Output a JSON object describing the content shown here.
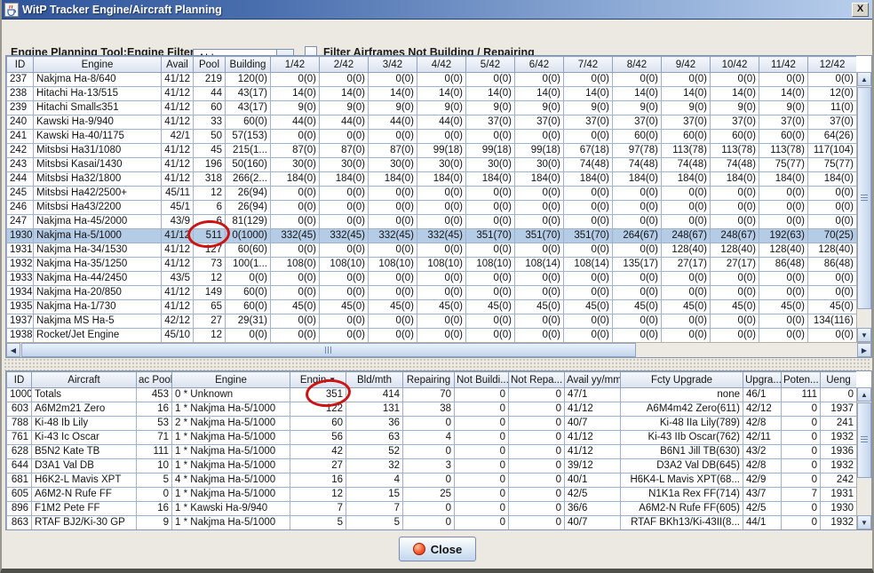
{
  "window": {
    "title": "WitP Tracker Engine/Aircraft Planning",
    "close_glyph": "X"
  },
  "toolbar": {
    "tool_label": "Engine Planning Tool:",
    "filter_label": "Engine Filter:",
    "filter_value": "ALL",
    "checkbox_label": "Filter Airframes Not Building / Repairing",
    "checkbox_checked": false
  },
  "engine_table": {
    "columns": [
      "ID",
      "Engine",
      "Avail",
      "Pool",
      "Building",
      "1/42",
      "2/42",
      "3/42",
      "4/42",
      "5/42",
      "6/42",
      "7/42",
      "8/42",
      "9/42",
      "10/42",
      "11/42",
      "12/42"
    ],
    "selected_row_id": "1930",
    "rows": [
      [
        "237",
        "Nakjma Ha-8/640",
        "41/12",
        "219",
        "120(0)",
        "0(0)",
        "0(0)",
        "0(0)",
        "0(0)",
        "0(0)",
        "0(0)",
        "0(0)",
        "0(0)",
        "0(0)",
        "0(0)",
        "0(0)",
        "0(0)"
      ],
      [
        "238",
        "Hitachi Ha-13/515",
        "41/12",
        "44",
        "43(17)",
        "14(0)",
        "14(0)",
        "14(0)",
        "14(0)",
        "14(0)",
        "14(0)",
        "14(0)",
        "14(0)",
        "14(0)",
        "14(0)",
        "14(0)",
        "12(0)"
      ],
      [
        "239",
        "Hitachi Small≤351",
        "41/12",
        "60",
        "43(17)",
        "9(0)",
        "9(0)",
        "9(0)",
        "9(0)",
        "9(0)",
        "9(0)",
        "9(0)",
        "9(0)",
        "9(0)",
        "9(0)",
        "9(0)",
        "11(0)"
      ],
      [
        "240",
        "Kawski Ha-9/940",
        "41/12",
        "33",
        "60(0)",
        "44(0)",
        "44(0)",
        "44(0)",
        "44(0)",
        "37(0)",
        "37(0)",
        "37(0)",
        "37(0)",
        "37(0)",
        "37(0)",
        "37(0)",
        "37(0)"
      ],
      [
        "241",
        "Kawski Ha-40/1175",
        "42/1",
        "50",
        "57(153)",
        "0(0)",
        "0(0)",
        "0(0)",
        "0(0)",
        "0(0)",
        "0(0)",
        "0(0)",
        "60(0)",
        "60(0)",
        "60(0)",
        "60(0)",
        "64(26)"
      ],
      [
        "242",
        "Mitsbsi Ha31/1080",
        "41/12",
        "45",
        "215(1...",
        "87(0)",
        "87(0)",
        "87(0)",
        "99(18)",
        "99(18)",
        "99(18)",
        "67(18)",
        "97(78)",
        "113(78)",
        "113(78)",
        "113(78)",
        "117(104)"
      ],
      [
        "243",
        "Mitsbsi Kasai/1430",
        "41/12",
        "196",
        "50(160)",
        "30(0)",
        "30(0)",
        "30(0)",
        "30(0)",
        "30(0)",
        "30(0)",
        "74(48)",
        "74(48)",
        "74(48)",
        "74(48)",
        "75(77)",
        "75(77)"
      ],
      [
        "244",
        "Mitsbsi Ha32/1800",
        "41/12",
        "318",
        "266(2...",
        "184(0)",
        "184(0)",
        "184(0)",
        "184(0)",
        "184(0)",
        "184(0)",
        "184(0)",
        "184(0)",
        "184(0)",
        "184(0)",
        "184(0)",
        "184(0)"
      ],
      [
        "245",
        "Mitsbsi Ha42/2500+",
        "45/11",
        "12",
        "26(94)",
        "0(0)",
        "0(0)",
        "0(0)",
        "0(0)",
        "0(0)",
        "0(0)",
        "0(0)",
        "0(0)",
        "0(0)",
        "0(0)",
        "0(0)",
        "0(0)"
      ],
      [
        "246",
        "Mitsbsi Ha43/2200",
        "45/1",
        "6",
        "26(94)",
        "0(0)",
        "0(0)",
        "0(0)",
        "0(0)",
        "0(0)",
        "0(0)",
        "0(0)",
        "0(0)",
        "0(0)",
        "0(0)",
        "0(0)",
        "0(0)"
      ],
      [
        "247",
        "Nakjma Ha-45/2000",
        "43/9",
        "6",
        "81(129)",
        "0(0)",
        "0(0)",
        "0(0)",
        "0(0)",
        "0(0)",
        "0(0)",
        "0(0)",
        "0(0)",
        "0(0)",
        "0(0)",
        "0(0)",
        "0(0)"
      ],
      [
        "1930",
        "Nakjma Ha-5/1000",
        "41/12",
        "511",
        "0(1000)",
        "332(45)",
        "332(45)",
        "332(45)",
        "332(45)",
        "351(70)",
        "351(70)",
        "351(70)",
        "264(67)",
        "248(67)",
        "248(67)",
        "192(63)",
        "70(25)"
      ],
      [
        "1931",
        "Nakjma Ha-34/1530",
        "41/12",
        "127",
        "60(60)",
        "0(0)",
        "0(0)",
        "0(0)",
        "0(0)",
        "0(0)",
        "0(0)",
        "0(0)",
        "0(0)",
        "128(40)",
        "128(40)",
        "128(40)",
        "128(40)"
      ],
      [
        "1932",
        "Nakjma Ha-35/1250",
        "41/12",
        "73",
        "100(1...",
        "108(0)",
        "108(10)",
        "108(10)",
        "108(10)",
        "108(10)",
        "108(14)",
        "108(14)",
        "135(17)",
        "27(17)",
        "27(17)",
        "86(48)",
        "86(48)"
      ],
      [
        "1933",
        "Nakjma Ha-44/2450",
        "43/5",
        "12",
        "0(0)",
        "0(0)",
        "0(0)",
        "0(0)",
        "0(0)",
        "0(0)",
        "0(0)",
        "0(0)",
        "0(0)",
        "0(0)",
        "0(0)",
        "0(0)",
        "0(0)"
      ],
      [
        "1934",
        "Nakjma Ha-20/850",
        "41/12",
        "149",
        "60(0)",
        "0(0)",
        "0(0)",
        "0(0)",
        "0(0)",
        "0(0)",
        "0(0)",
        "0(0)",
        "0(0)",
        "0(0)",
        "0(0)",
        "0(0)",
        "0(0)"
      ],
      [
        "1935",
        "Nakjma Ha-1/730",
        "41/12",
        "65",
        "60(0)",
        "45(0)",
        "45(0)",
        "45(0)",
        "45(0)",
        "45(0)",
        "45(0)",
        "45(0)",
        "45(0)",
        "45(0)",
        "45(0)",
        "45(0)",
        "45(0)"
      ],
      [
        "1937",
        "Nakjma MS Ha-5",
        "42/12",
        "27",
        "29(31)",
        "0(0)",
        "0(0)",
        "0(0)",
        "0(0)",
        "0(0)",
        "0(0)",
        "0(0)",
        "0(0)",
        "0(0)",
        "0(0)",
        "0(0)",
        "134(116)"
      ],
      [
        "1938",
        "Rocket/Jet Engine",
        "45/10",
        "12",
        "0(0)",
        "0(0)",
        "0(0)",
        "0(0)",
        "0(0)",
        "0(0)",
        "0(0)",
        "0(0)",
        "0(0)",
        "0(0)",
        "0(0)",
        "0(0)",
        "0(0)"
      ]
    ]
  },
  "aircraft_table": {
    "columns": [
      "ID",
      "Aircraft",
      "ac Pool",
      "Engine",
      "Engin",
      "Bld/mth",
      "Repairing",
      "Not Buildi...",
      "Not Repa...",
      "Avail yy/mm",
      "Fcty Upgrade",
      "Upgra...",
      "Poten...",
      "Ueng"
    ],
    "sort_column": "Engin",
    "sort_glyph": "▼",
    "rows": [
      [
        "1000",
        "Totals",
        "453",
        "0 * Unknown",
        "351",
        "414",
        "70",
        "0",
        "0",
        "47/1",
        "none",
        "46/1",
        "111",
        "0"
      ],
      [
        "603",
        "A6M2m21 Zero",
        "16",
        "1 * Nakjma Ha-5/1000",
        "122",
        "131",
        "38",
        "0",
        "0",
        "41/12",
        "A6M4m42 Zero(611)",
        "42/12",
        "0",
        "1937"
      ],
      [
        "788",
        "Ki-48 Ib Lily",
        "53",
        "2 * Nakjma Ha-5/1000",
        "60",
        "36",
        "0",
        "0",
        "0",
        "40/7",
        "Ki-48 IIa Lily(789)",
        "42/8",
        "0",
        "241"
      ],
      [
        "761",
        "Ki-43 Ic Oscar",
        "71",
        "1 * Nakjma Ha-5/1000",
        "56",
        "63",
        "4",
        "0",
        "0",
        "41/12",
        "Ki-43 IIb Oscar(762)",
        "42/11",
        "0",
        "1932"
      ],
      [
        "628",
        "B5N2 Kate TB",
        "111",
        "1 * Nakjma Ha-5/1000",
        "42",
        "52",
        "0",
        "0",
        "0",
        "41/12",
        "B6N1 Jill TB(630)",
        "43/2",
        "0",
        "1936"
      ],
      [
        "644",
        "D3A1 Val DB",
        "10",
        "1 * Nakjma Ha-5/1000",
        "27",
        "32",
        "3",
        "0",
        "0",
        "39/12",
        "D3A2 Val DB(645)",
        "42/8",
        "0",
        "1932"
      ],
      [
        "681",
        "H6K2-L Mavis XPT",
        "5",
        "4 * Nakjma Ha-5/1000",
        "16",
        "4",
        "0",
        "0",
        "0",
        "40/1",
        "H6K4-L Mavis XPT(68...",
        "42/9",
        "0",
        "242"
      ],
      [
        "605",
        "A6M2-N Rufe FF",
        "0",
        "1 * Nakjma Ha-5/1000",
        "12",
        "15",
        "25",
        "0",
        "0",
        "42/5",
        "N1K1a Rex FF(714)",
        "43/7",
        "7",
        "1931"
      ],
      [
        "896",
        "F1M2 Pete FF",
        "16",
        "1 * Kawski Ha-9/940",
        "7",
        "7",
        "0",
        "0",
        "0",
        "36/6",
        "A6M2-N Rufe FF(605)",
        "42/5",
        "0",
        "1930"
      ],
      [
        "863",
        "RTAF BJ2/Ki-30 GP",
        "9",
        "1 * Nakjma Ha-5/1000",
        "5",
        "5",
        "0",
        "0",
        "0",
        "40/7",
        "RTAF BKh13/Ki-43II(8...",
        "44/1",
        "0",
        "1932"
      ]
    ]
  },
  "annotations": [
    {
      "shape": "ellipse",
      "color": "#cc1414",
      "target": "engine-row-1930-pool",
      "circled_value": "511"
    },
    {
      "shape": "ellipse",
      "color": "#cc1414",
      "target": "aircraft-row-1000-engines-needed",
      "circled_value": "351"
    }
  ],
  "footer": {
    "close_label": "Close"
  },
  "colors": {
    "titlebar_start": "#2f549a",
    "titlebar_end": "#b9cfec",
    "selection": "#b5cce6",
    "grid_line": "#9fb2c8",
    "annotation": "#cc1414",
    "window_bg": "#ece9e2",
    "stop_icon": "#f75c2e"
  }
}
